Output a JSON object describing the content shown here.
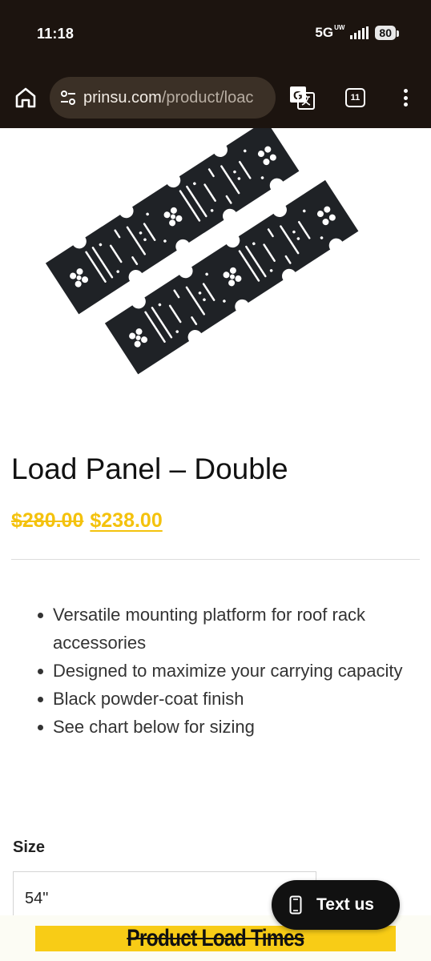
{
  "status_bar": {
    "time": "11:18",
    "network": "5G",
    "network_sub": "UW",
    "battery": "80"
  },
  "browser": {
    "url_domain": "prinsu.com",
    "url_path": "/product/loac",
    "tab_count": "11"
  },
  "product": {
    "title": "Load Panel – Double",
    "price_original": "$280.00",
    "price_sale": "$238.00",
    "features": [
      "Versatile mounting platform for roof rack accessories",
      "Designed to maximize your carrying capacity",
      "Black powder-coat finish",
      "See chart below for sizing"
    ],
    "size_label": "Size",
    "size_selected": "54\""
  },
  "chat_button": {
    "label": "Text us"
  },
  "banner": {
    "text": "Product Load Times"
  },
  "colors": {
    "chrome_bg": "#1c140f",
    "url_pill_bg": "#3b3026",
    "accent_yellow": "#f4c20d",
    "banner_yellow": "#f8cc16"
  }
}
